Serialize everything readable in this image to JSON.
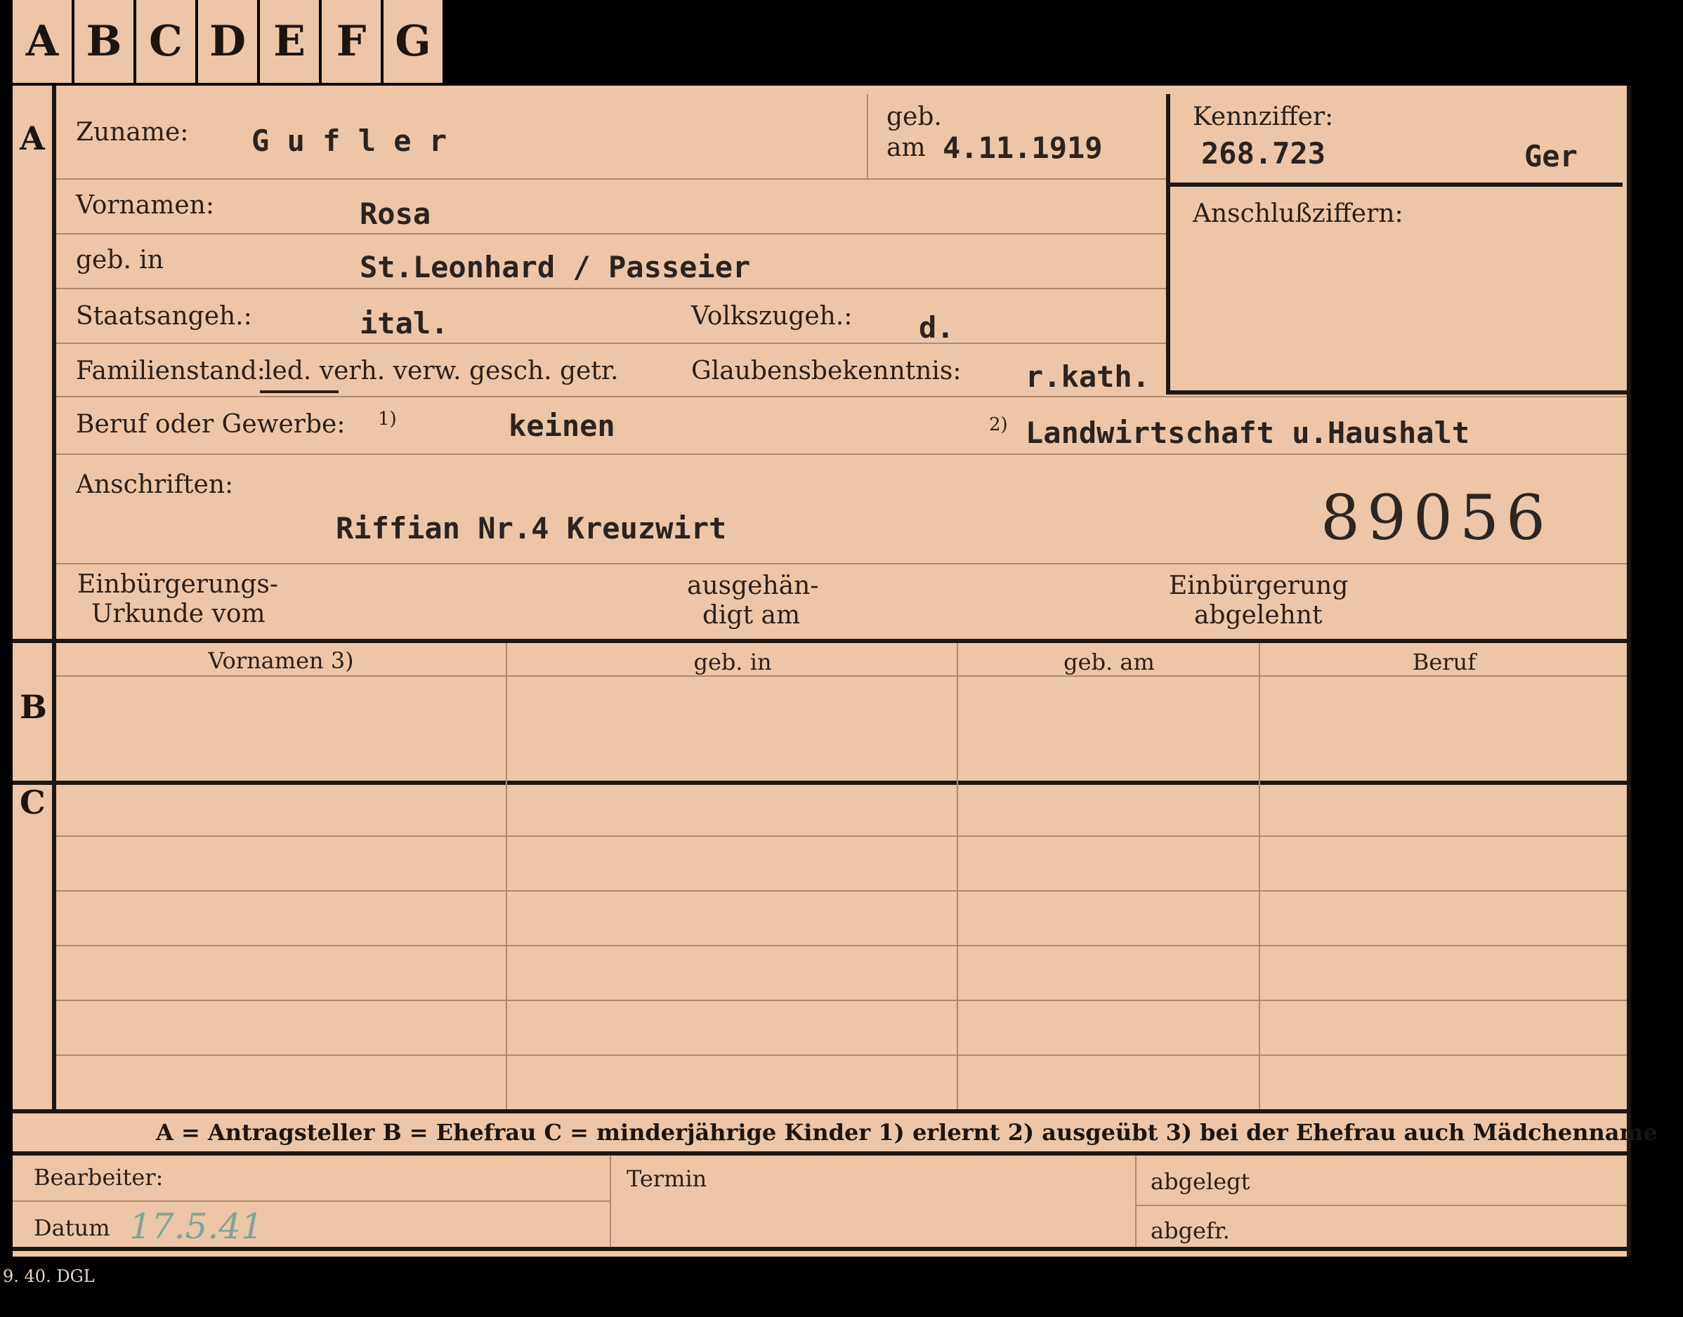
{
  "tabs": [
    "A",
    "B",
    "C",
    "D",
    "E",
    "F",
    "G"
  ],
  "sections": {
    "a": "A",
    "b": "B",
    "c": "C"
  },
  "header": {
    "zuname_label": "Zuname:",
    "zuname_value": "G u f l e r",
    "geb_label": "geb.",
    "am_label": "am",
    "geb_am_value": "4.11.1919",
    "kennziffer_label": "Kennziffer:",
    "kennziffer_value": "268.723",
    "kennziffer_suffix": "Ger",
    "anschluss_label": "Anschlußziffern:"
  },
  "fields": {
    "vornamen_label": "Vornamen:",
    "vornamen_value": "Rosa",
    "geb_in_label": "geb. in",
    "geb_in_value": "St.Leonhard / Passeier",
    "staatsangeh_label": "Staatsangeh.:",
    "staatsangeh_value": "ital.",
    "volkszugeh_label": "Volkszugeh.:",
    "volkszugeh_value": "d.",
    "familienstand_label": "Familienstand:",
    "familienstand_options": "led. verh. verw. gesch. getr.",
    "glauben_label": "Glaubensbekenntnis:",
    "glauben_value": "r.kath.",
    "beruf_label": "Beruf oder Gewerbe:",
    "beruf_mark1": "1)",
    "beruf_value1": "keinen",
    "beruf_mark2": "2)",
    "beruf_value2": "Landwirtschaft u.Haushalt",
    "anschriften_label": "Anschriften:",
    "anschriften_value": "Riffian Nr.4 Kreuzwirt",
    "stamp_number": "89056",
    "einb_urkunde_line1": "Einbürgerungs-",
    "einb_urkunde_line2": "Urkunde vom",
    "ausgehaendigt_line1": "ausgehän-",
    "ausgehaendigt_line2": "digt am",
    "abgelehnt_line1": "Einbürgerung",
    "abgelehnt_line2": "abgelehnt"
  },
  "table_headers": [
    "Vornamen 3)",
    "geb. in",
    "geb. am",
    "Beruf"
  ],
  "legend": "A = Antragsteller   B = Ehefrau   C = minderjährige Kinder   1) erlernt   2) ausgeübt   3) bei der Ehefrau auch Mädchenname",
  "footer": {
    "bearbeiter_label": "Bearbeiter:",
    "datum_label": "Datum",
    "datum_value": "17.5.41",
    "termin_label": "Termin",
    "abgelegt_label": "abgelegt",
    "abgefr_label": "abgefr."
  },
  "print_mark": "9. 40. DGL",
  "colors": {
    "card": "#ecc6a6",
    "ink": "#2a1f18",
    "frame": "#1d1713",
    "pencil": "#7fa39a"
  }
}
